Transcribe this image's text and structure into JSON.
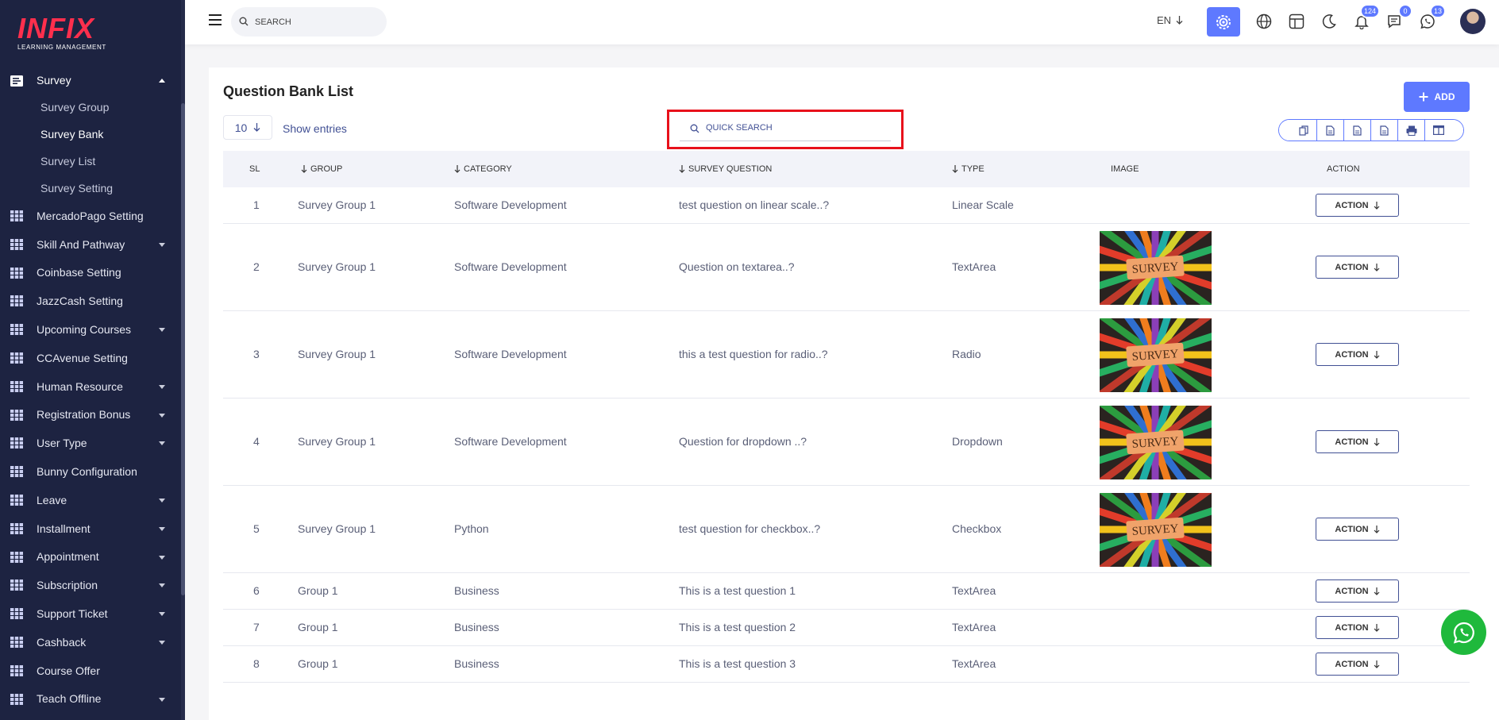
{
  "brand": {
    "logo_word": "INFIX",
    "logo_sub": "LEARNING MANAGEMENT"
  },
  "sidebar": {
    "survey": {
      "label": "Survey",
      "children": [
        "Survey Group",
        "Survey Bank",
        "Survey List",
        "Survey Setting"
      ]
    },
    "items": [
      {
        "label": "MercadoPago Setting",
        "caret": false
      },
      {
        "label": "Skill And Pathway",
        "caret": true
      },
      {
        "label": "Coinbase Setting",
        "caret": false
      },
      {
        "label": "JazzCash Setting",
        "caret": false
      },
      {
        "label": "Upcoming Courses",
        "caret": true
      },
      {
        "label": "CCAvenue Setting",
        "caret": false
      },
      {
        "label": "Human Resource",
        "caret": true
      },
      {
        "label": "Registration Bonus",
        "caret": true
      },
      {
        "label": "User Type",
        "caret": true
      },
      {
        "label": "Bunny Configuration",
        "caret": false
      },
      {
        "label": "Leave",
        "caret": true
      },
      {
        "label": "Installment",
        "caret": true
      },
      {
        "label": "Appointment",
        "caret": true
      },
      {
        "label": "Subscription",
        "caret": true
      },
      {
        "label": "Support Ticket",
        "caret": true
      },
      {
        "label": "Cashback",
        "caret": true
      },
      {
        "label": "Course Offer",
        "caret": false
      },
      {
        "label": "Teach Offline",
        "caret": true
      }
    ]
  },
  "topbar": {
    "search_placeholder": "SEARCH",
    "language": "EN",
    "notifications_count": "124",
    "messages_count": "0",
    "chat_count": "13"
  },
  "page": {
    "title": "Question Bank List",
    "add_label": "ADD",
    "entries_value": "10",
    "show_entries_label": "Show entries",
    "quick_search_placeholder": "QUICK SEARCH"
  },
  "table": {
    "headers": {
      "sl": "SL",
      "group": "GROUP",
      "category": "CATEGORY",
      "question": "SURVEY QUESTION",
      "type": "TYPE",
      "image": "IMAGE",
      "action": "ACTION"
    },
    "image_label": "SURVEY",
    "action_label": "ACTION",
    "rows": [
      {
        "sl": "1",
        "group": "Survey Group 1",
        "category": "Software Development",
        "question": "test question on linear scale..?",
        "type": "Linear Scale",
        "has_image": false
      },
      {
        "sl": "2",
        "group": "Survey Group 1",
        "category": "Software Development",
        "question": "Question on textarea..?",
        "type": "TextArea",
        "has_image": true
      },
      {
        "sl": "3",
        "group": "Survey Group 1",
        "category": "Software Development",
        "question": "this a test question for radio..?",
        "type": "Radio",
        "has_image": true
      },
      {
        "sl": "4",
        "group": "Survey Group 1",
        "category": "Software Development",
        "question": "Question for dropdown ..?",
        "type": "Dropdown",
        "has_image": true
      },
      {
        "sl": "5",
        "group": "Survey Group 1",
        "category": "Python",
        "question": "test question for checkbox..?",
        "type": "Checkbox",
        "has_image": true
      },
      {
        "sl": "6",
        "group": "Group 1",
        "category": "Business",
        "question": "This is a test question 1",
        "type": "TextArea",
        "has_image": false
      },
      {
        "sl": "7",
        "group": "Group 1",
        "category": "Business",
        "question": "This is a test question 2",
        "type": "TextArea",
        "has_image": false
      },
      {
        "sl": "8",
        "group": "Group 1",
        "category": "Business",
        "question": "This is a test question 3",
        "type": "TextArea",
        "has_image": false
      }
    ]
  },
  "colors": {
    "accent": "#5e79ff",
    "sidebar_bg": "#1d2341",
    "text": "#415094",
    "highlight": "#e8111b",
    "whatsapp": "#1fb93c"
  },
  "icons": {
    "topbar": [
      "menu-icon",
      "search-icon",
      "chevron-down-icon",
      "cog-icon",
      "globe-icon",
      "layout-icon",
      "moon-icon",
      "bell-icon",
      "message-icon",
      "whatsapp-icon"
    ],
    "export": [
      "copy-icon",
      "csv-icon",
      "excel-icon",
      "pdf-icon",
      "print-icon",
      "columns-icon"
    ]
  }
}
